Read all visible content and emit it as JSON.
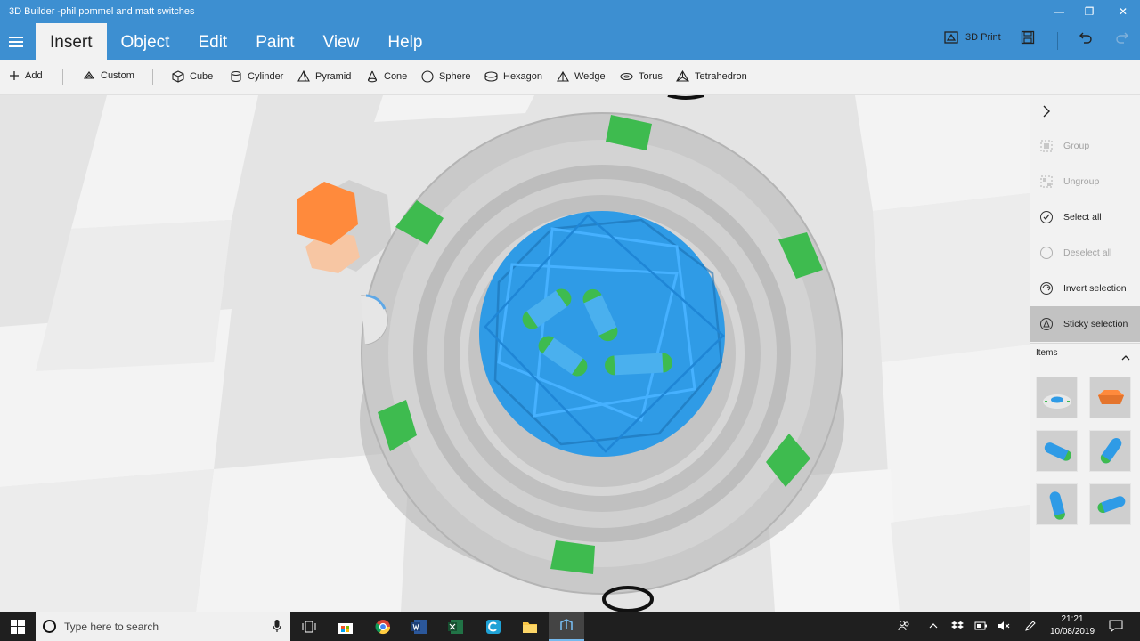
{
  "window": {
    "title": "3D Builder -phil pommel and matt switches",
    "minimize_icon": "—",
    "maximize_icon": "❐",
    "close_icon": "✕"
  },
  "menu": {
    "tabs": [
      "Insert",
      "Object",
      "Edit",
      "Paint",
      "View",
      "Help"
    ],
    "active_tab": "Insert",
    "print_label": "3D Print"
  },
  "toolbar": {
    "add": "Add",
    "custom": "Custom",
    "shapes": [
      "Cube",
      "Cylinder",
      "Pyramid",
      "Cone",
      "Sphere",
      "Hexagon",
      "Wedge",
      "Torus",
      "Tetrahedron"
    ]
  },
  "panel": {
    "collapse_icon": "chevron-right-icon",
    "actions": [
      {
        "label": "Group",
        "enabled": false,
        "active": false
      },
      {
        "label": "Ungroup",
        "enabled": false,
        "active": false
      },
      {
        "label": "Select all",
        "enabled": true,
        "active": false
      },
      {
        "label": "Deselect all",
        "enabled": false,
        "active": false
      },
      {
        "label": "Invert selection",
        "enabled": true,
        "active": false
      },
      {
        "label": "Sticky selection",
        "enabled": true,
        "active": true
      }
    ],
    "items_header": "Items",
    "item_thumbnails": [
      "ring-model-thumb",
      "hexagon-thumb",
      "capsule-thumb",
      "capsule-thumb",
      "capsule-thumb",
      "capsule-thumb"
    ]
  },
  "taskbar": {
    "search_placeholder": "Type here to search",
    "time": "21:21",
    "date": "10/08/2019"
  },
  "colors": {
    "accent": "#3d8fd1",
    "blue_part": "#2f9be6",
    "green_part": "#3ebb4f",
    "orange_part": "#ff8a3c",
    "gray_part": "#c6c6c6"
  }
}
